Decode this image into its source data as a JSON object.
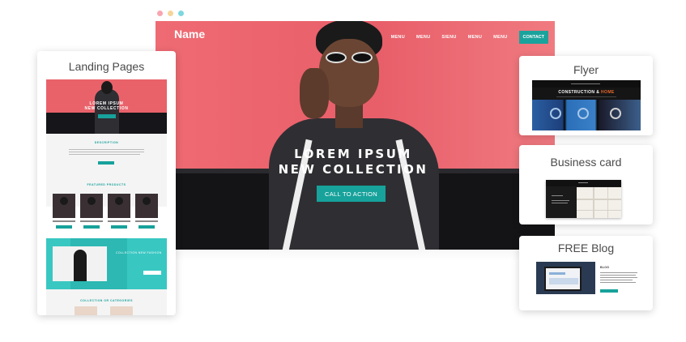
{
  "colors": {
    "dot_red": "#f9a5b0",
    "dot_yellow": "#f6d59a",
    "dot_teal": "#7ed7de",
    "hero_bg": "#ec6570",
    "accent_teal": "#17a29b",
    "flyer_highlight": "#ee6a2a"
  },
  "hero": {
    "brand": "Name",
    "nav": [
      "MENU",
      "MENU",
      "SIENU",
      "MENU",
      "MENU"
    ],
    "contact_label": "CONTACT",
    "title_line1": "LOREM IPSUM",
    "title_line2": "NEW COLLECTION",
    "cta_label": "CALL TO ACTION"
  },
  "cards": {
    "landing": {
      "title": "Landing Pages",
      "hero_line1": "LOREM IPSUM",
      "hero_line2": "NEW COLLECTION",
      "description_heading": "DESCRIPTION",
      "products_heading": "FEATURED PRODUCTS",
      "collection_text": "COLLECTION NEW FASHION",
      "categories_heading": "COLLECTION OR CATEGORIES"
    },
    "flyer": {
      "title": "Flyer",
      "headline": "CONSTRUCTION &",
      "headline_highlight": "HOME"
    },
    "business": {
      "title": "Business card"
    },
    "blog": {
      "title": "FREE Blog",
      "label": "BLOG"
    }
  }
}
